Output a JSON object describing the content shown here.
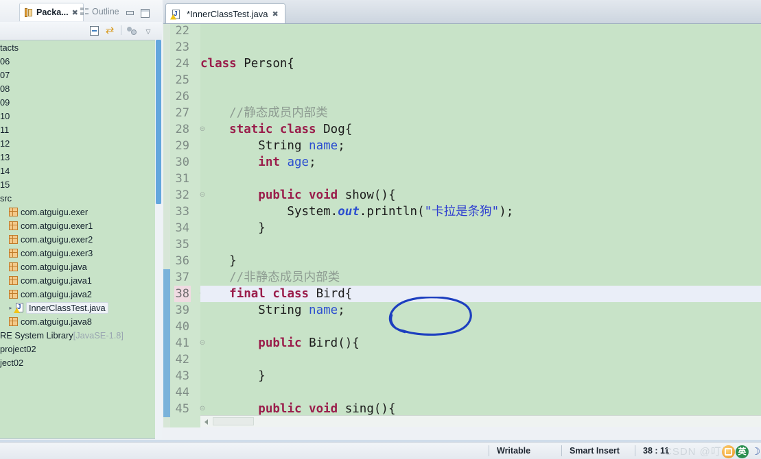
{
  "window": {
    "theme_bg": "#c8e3c8",
    "accent": "#2a53a8"
  },
  "left_panel": {
    "tabs": [
      {
        "label": "Packa...",
        "icon": "package-explorer-icon",
        "close": "✖",
        "active": true
      },
      {
        "label": "Outline",
        "icon": "outline-icon",
        "close": "",
        "active": false
      }
    ],
    "window_buttons": {
      "minimize": "minimize-icon",
      "maximize": "maximize-icon"
    },
    "toolbar": {
      "collapse_all": "collapse-all-icon",
      "link_with_editor": "link-with-editor-icon",
      "focus": "focus-icon",
      "view_menu": "▽"
    },
    "tree": [
      {
        "label": "tacts",
        "icon": "none",
        "indent": 0,
        "arrow": "",
        "selected": false,
        "suffix": ""
      },
      {
        "label": "06",
        "icon": "none",
        "indent": 0,
        "arrow": "",
        "selected": false,
        "suffix": ""
      },
      {
        "label": "07",
        "icon": "none",
        "indent": 0,
        "arrow": "",
        "selected": false,
        "suffix": ""
      },
      {
        "label": "08",
        "icon": "none",
        "indent": 0,
        "arrow": "",
        "selected": false,
        "suffix": ""
      },
      {
        "label": "09",
        "icon": "none",
        "indent": 0,
        "arrow": "",
        "selected": false,
        "suffix": ""
      },
      {
        "label": "10",
        "icon": "none",
        "indent": 0,
        "arrow": "",
        "selected": false,
        "suffix": ""
      },
      {
        "label": "11",
        "icon": "none",
        "indent": 0,
        "arrow": "",
        "selected": false,
        "suffix": ""
      },
      {
        "label": "12",
        "icon": "none",
        "indent": 0,
        "arrow": "",
        "selected": false,
        "suffix": ""
      },
      {
        "label": "13",
        "icon": "none",
        "indent": 0,
        "arrow": "",
        "selected": false,
        "suffix": ""
      },
      {
        "label": "14",
        "icon": "none",
        "indent": 0,
        "arrow": "",
        "selected": false,
        "suffix": ""
      },
      {
        "label": "15",
        "icon": "none",
        "indent": 0,
        "arrow": "",
        "selected": false,
        "suffix": ""
      },
      {
        "label": "src",
        "icon": "none",
        "indent": 0,
        "arrow": "",
        "selected": false,
        "suffix": ""
      },
      {
        "label": "com.atguigu.exer",
        "icon": "package",
        "indent": 1,
        "arrow": "",
        "selected": false,
        "suffix": ""
      },
      {
        "label": "com.atguigu.exer1",
        "icon": "package",
        "indent": 1,
        "arrow": "",
        "selected": false,
        "suffix": ""
      },
      {
        "label": "com.atguigu.exer2",
        "icon": "package",
        "indent": 1,
        "arrow": "",
        "selected": false,
        "suffix": ""
      },
      {
        "label": "com.atguigu.exer3",
        "icon": "package",
        "indent": 1,
        "arrow": "",
        "selected": false,
        "suffix": ""
      },
      {
        "label": "com.atguigu.java",
        "icon": "package",
        "indent": 1,
        "arrow": "",
        "selected": false,
        "suffix": ""
      },
      {
        "label": "com.atguigu.java1",
        "icon": "package",
        "indent": 1,
        "arrow": "",
        "selected": false,
        "suffix": ""
      },
      {
        "label": "com.atguigu.java2",
        "icon": "package",
        "indent": 1,
        "arrow": "",
        "selected": false,
        "suffix": ""
      },
      {
        "label": "InnerClassTest.java",
        "icon": "java-warning",
        "indent": 2,
        "arrow": "▸",
        "selected": true,
        "suffix": ""
      },
      {
        "label": "com.atguigu.java8",
        "icon": "package",
        "indent": 1,
        "arrow": "",
        "selected": false,
        "suffix": ""
      },
      {
        "label": "RE System Library",
        "icon": "none",
        "indent": 0,
        "arrow": "",
        "selected": false,
        "suffix": "[JavaSE-1.8]"
      },
      {
        "label": "project02",
        "icon": "none",
        "indent": 0,
        "arrow": "",
        "selected": false,
        "suffix": ""
      },
      {
        "label": "ject02",
        "icon": "none",
        "indent": 0,
        "arrow": "",
        "selected": false,
        "suffix": ""
      }
    ]
  },
  "editor": {
    "tab": {
      "label": "*InnerClassTest.java",
      "icon": "java-warning-icon",
      "close": "✖",
      "dirty": true
    },
    "first_line": 22,
    "highlight_line": 38,
    "changed_lines": {
      "from": 37,
      "to": 45
    },
    "fold_lines": [
      28,
      32,
      38,
      41,
      45
    ],
    "lines": [
      {
        "n": 22,
        "tokens": []
      },
      {
        "n": 23,
        "tokens": []
      },
      {
        "n": 24,
        "tokens": [
          {
            "t": "class ",
            "c": "kw"
          },
          {
            "t": "Person{",
            "c": ""
          }
        ]
      },
      {
        "n": 25,
        "tokens": []
      },
      {
        "n": 26,
        "tokens": []
      },
      {
        "n": 27,
        "tokens": [
          {
            "t": "    //静态成员内部类",
            "c": "cm"
          }
        ]
      },
      {
        "n": 28,
        "tokens": [
          {
            "t": "    ",
            "c": ""
          },
          {
            "t": "static class ",
            "c": "kw"
          },
          {
            "t": "Dog{",
            "c": ""
          }
        ]
      },
      {
        "n": 29,
        "tokens": [
          {
            "t": "        String ",
            "c": ""
          },
          {
            "t": "name",
            "c": "fld"
          },
          {
            "t": ";",
            "c": ""
          }
        ]
      },
      {
        "n": 30,
        "tokens": [
          {
            "t": "        ",
            "c": ""
          },
          {
            "t": "int ",
            "c": "kw"
          },
          {
            "t": "age",
            "c": "fld"
          },
          {
            "t": ";",
            "c": ""
          }
        ]
      },
      {
        "n": 31,
        "tokens": []
      },
      {
        "n": 32,
        "tokens": [
          {
            "t": "        ",
            "c": ""
          },
          {
            "t": "public void ",
            "c": "kw"
          },
          {
            "t": "show(){",
            "c": ""
          }
        ]
      },
      {
        "n": 33,
        "tokens": [
          {
            "t": "            System.",
            "c": ""
          },
          {
            "t": "out",
            "c": "stat"
          },
          {
            "t": ".println(",
            "c": ""
          },
          {
            "t": "\"卡拉是条狗\"",
            "c": "str"
          },
          {
            "t": ");",
            "c": ""
          }
        ]
      },
      {
        "n": 34,
        "tokens": [
          {
            "t": "        }",
            "c": ""
          }
        ]
      },
      {
        "n": 35,
        "tokens": []
      },
      {
        "n": 36,
        "tokens": [
          {
            "t": "    }",
            "c": ""
          }
        ]
      },
      {
        "n": 37,
        "tokens": [
          {
            "t": "    //非静态成员内部类",
            "c": "cm"
          }
        ]
      },
      {
        "n": 38,
        "tokens": [
          {
            "t": "    ",
            "c": ""
          },
          {
            "t": "final class ",
            "c": "kw"
          },
          {
            "t": "Bird{",
            "c": ""
          }
        ]
      },
      {
        "n": 39,
        "tokens": [
          {
            "t": "        String ",
            "c": ""
          },
          {
            "t": "name",
            "c": "fld"
          },
          {
            "t": ";",
            "c": ""
          }
        ]
      },
      {
        "n": 40,
        "tokens": []
      },
      {
        "n": 41,
        "tokens": [
          {
            "t": "        ",
            "c": ""
          },
          {
            "t": "public ",
            "c": "kw"
          },
          {
            "t": "Bird(){",
            "c": ""
          }
        ]
      },
      {
        "n": 42,
        "tokens": []
      },
      {
        "n": 43,
        "tokens": [
          {
            "t": "        }",
            "c": ""
          }
        ]
      },
      {
        "n": 44,
        "tokens": []
      },
      {
        "n": 45,
        "tokens": [
          {
            "t": "        ",
            "c": ""
          },
          {
            "t": "public void ",
            "c": "kw"
          },
          {
            "t": "sing(){",
            "c": ""
          }
        ]
      }
    ],
    "annotation": {
      "shape": "hand-drawn-ellipse",
      "color": "#1d3fbf",
      "targets": "final class"
    }
  },
  "status_bar": {
    "writable": "Writable",
    "insert_mode": "Smart Insert",
    "cursor_position": "38 : 11",
    "watermark": "CSDN @叮当",
    "ime": {
      "tool": "ime-pen-icon",
      "lang": "英",
      "moon": "☽"
    }
  }
}
